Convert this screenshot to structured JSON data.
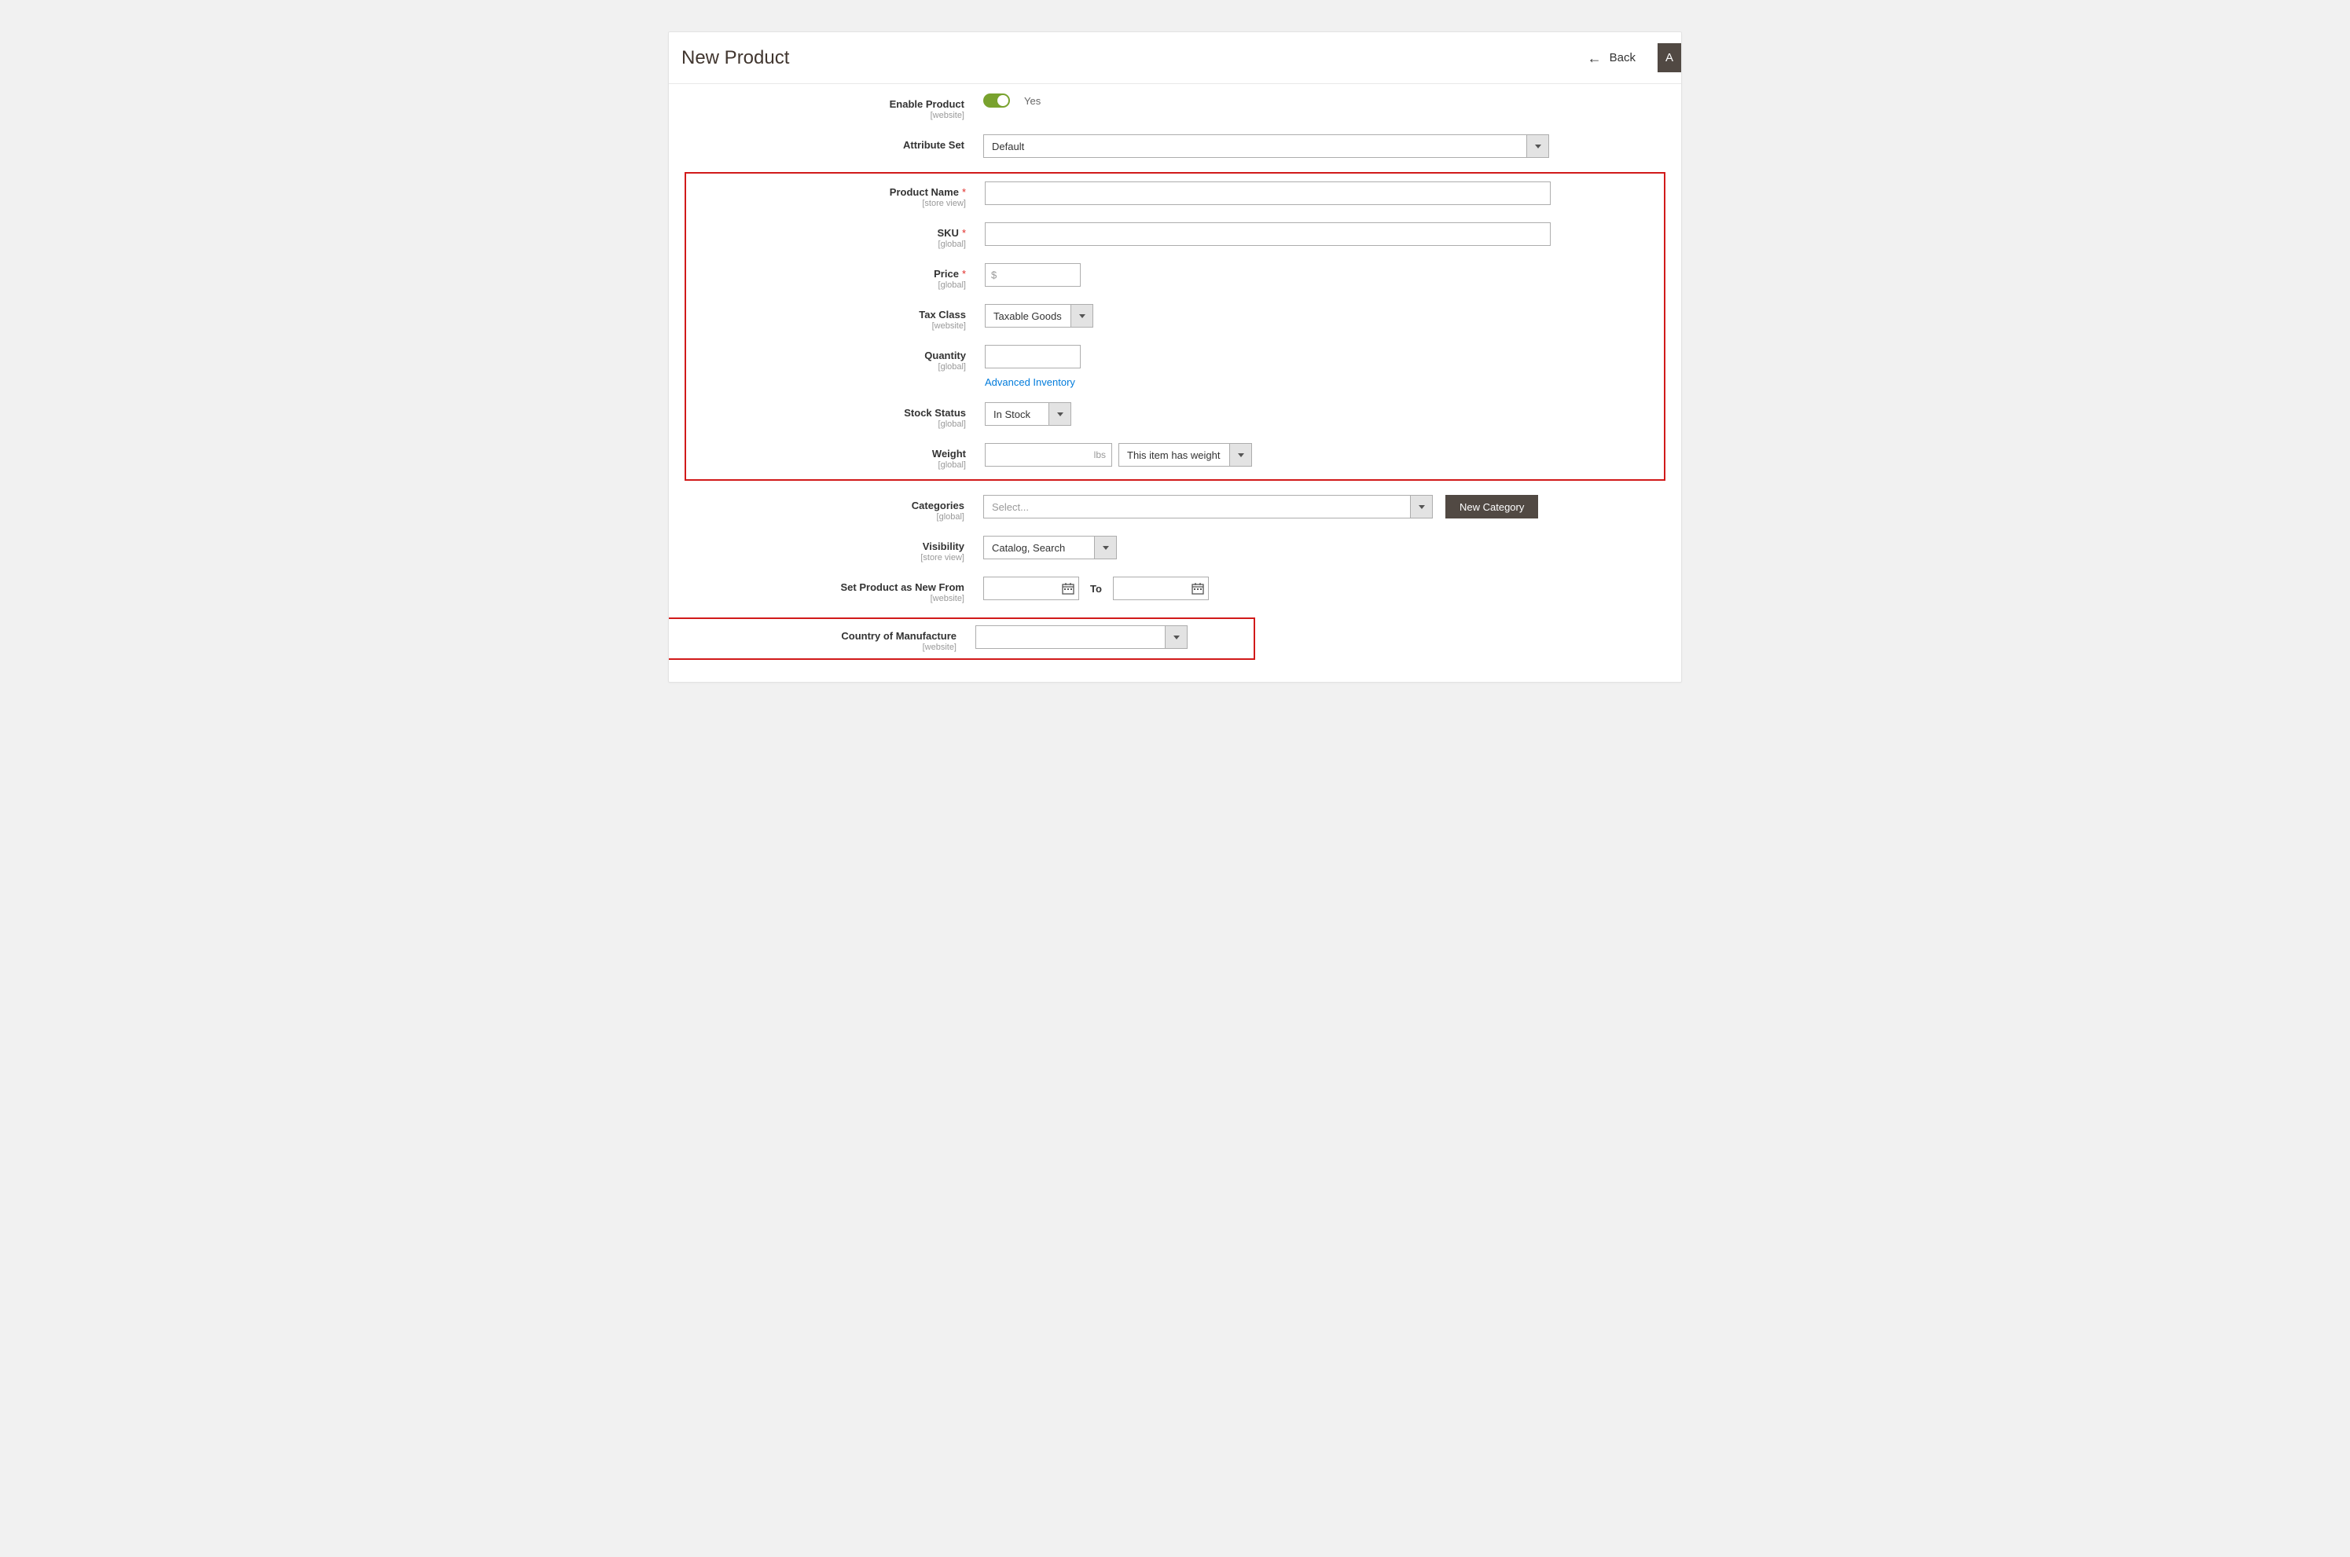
{
  "header": {
    "title": "New Product",
    "back_label": "Back",
    "action_label": "A"
  },
  "fields": {
    "enable_product": {
      "label": "Enable Product",
      "scope": "[website]",
      "value_text": "Yes"
    },
    "attribute_set": {
      "label": "Attribute Set",
      "value": "Default"
    },
    "product_name": {
      "label": "Product Name",
      "scope": "[store view]",
      "value": ""
    },
    "sku": {
      "label": "SKU",
      "scope": "[global]",
      "value": ""
    },
    "price": {
      "label": "Price",
      "scope": "[global]",
      "currency": "$",
      "value": ""
    },
    "tax_class": {
      "label": "Tax Class",
      "scope": "[website]",
      "value": "Taxable Goods"
    },
    "quantity": {
      "label": "Quantity",
      "scope": "[global]",
      "value": "",
      "advanced_link": "Advanced Inventory"
    },
    "stock_status": {
      "label": "Stock Status",
      "scope": "[global]",
      "value": "In Stock"
    },
    "weight": {
      "label": "Weight",
      "scope": "[global]",
      "unit": "lbs",
      "select_value": "This item has weight",
      "value": ""
    },
    "categories": {
      "label": "Categories",
      "scope": "[global]",
      "placeholder": "Select...",
      "new_btn": "New Category"
    },
    "visibility": {
      "label": "Visibility",
      "scope": "[store view]",
      "value": "Catalog, Search"
    },
    "set_new": {
      "label": "Set Product as New From",
      "scope": "[website]",
      "to_label": "To",
      "from_value": "",
      "to_value": ""
    },
    "country": {
      "label": "Country of Manufacture",
      "scope": "[website]",
      "value": ""
    }
  }
}
